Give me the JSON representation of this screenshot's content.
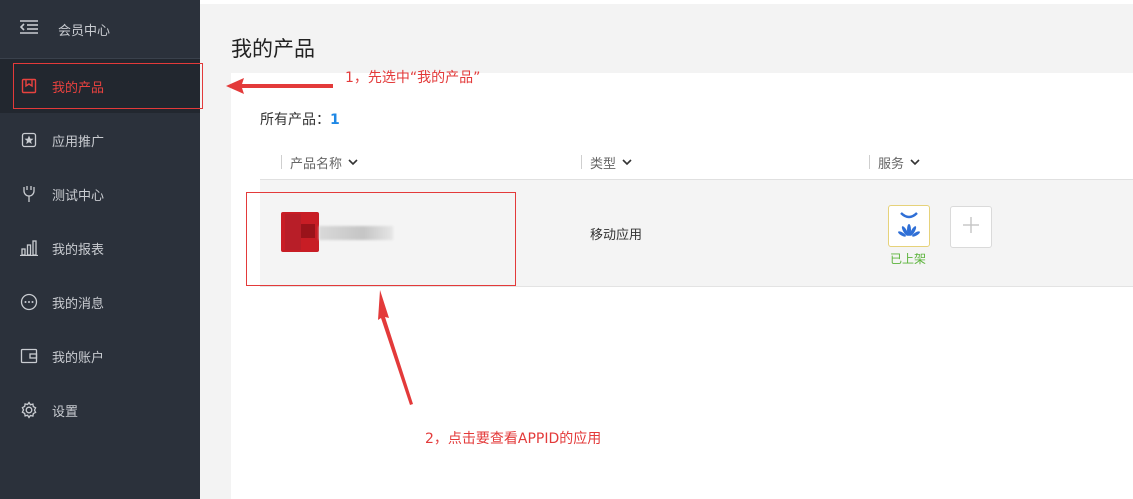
{
  "sidebar": {
    "header_label": "会员中心",
    "items": [
      {
        "label": "我的产品",
        "icon": "bookmark-icon",
        "active": true
      },
      {
        "label": "应用推广",
        "icon": "star-icon"
      },
      {
        "label": "测试中心",
        "icon": "plug-icon"
      },
      {
        "label": "我的报表",
        "icon": "bar-chart-icon"
      },
      {
        "label": "我的消息",
        "icon": "chat-icon"
      },
      {
        "label": "我的账户",
        "icon": "wallet-icon"
      },
      {
        "label": "设置",
        "icon": "gear-icon"
      }
    ]
  },
  "main": {
    "title": "我的产品",
    "summary_label": "所有产品：",
    "summary_count": "1",
    "columns": [
      "产品名称",
      "类型",
      "服务"
    ],
    "rows": [
      {
        "type": "移动应用",
        "service_status": "已上架"
      }
    ]
  },
  "annotations": {
    "step1": "1，先选中“我的产品”",
    "step2": "2，点击要查看APPID的应用"
  },
  "colors": {
    "accent_red": "#e8423f",
    "annotation_red": "#e33a3a",
    "count_blue": "#1e88e5",
    "status_green": "#5bb33b",
    "sidebar_bg": "#2b313b"
  }
}
